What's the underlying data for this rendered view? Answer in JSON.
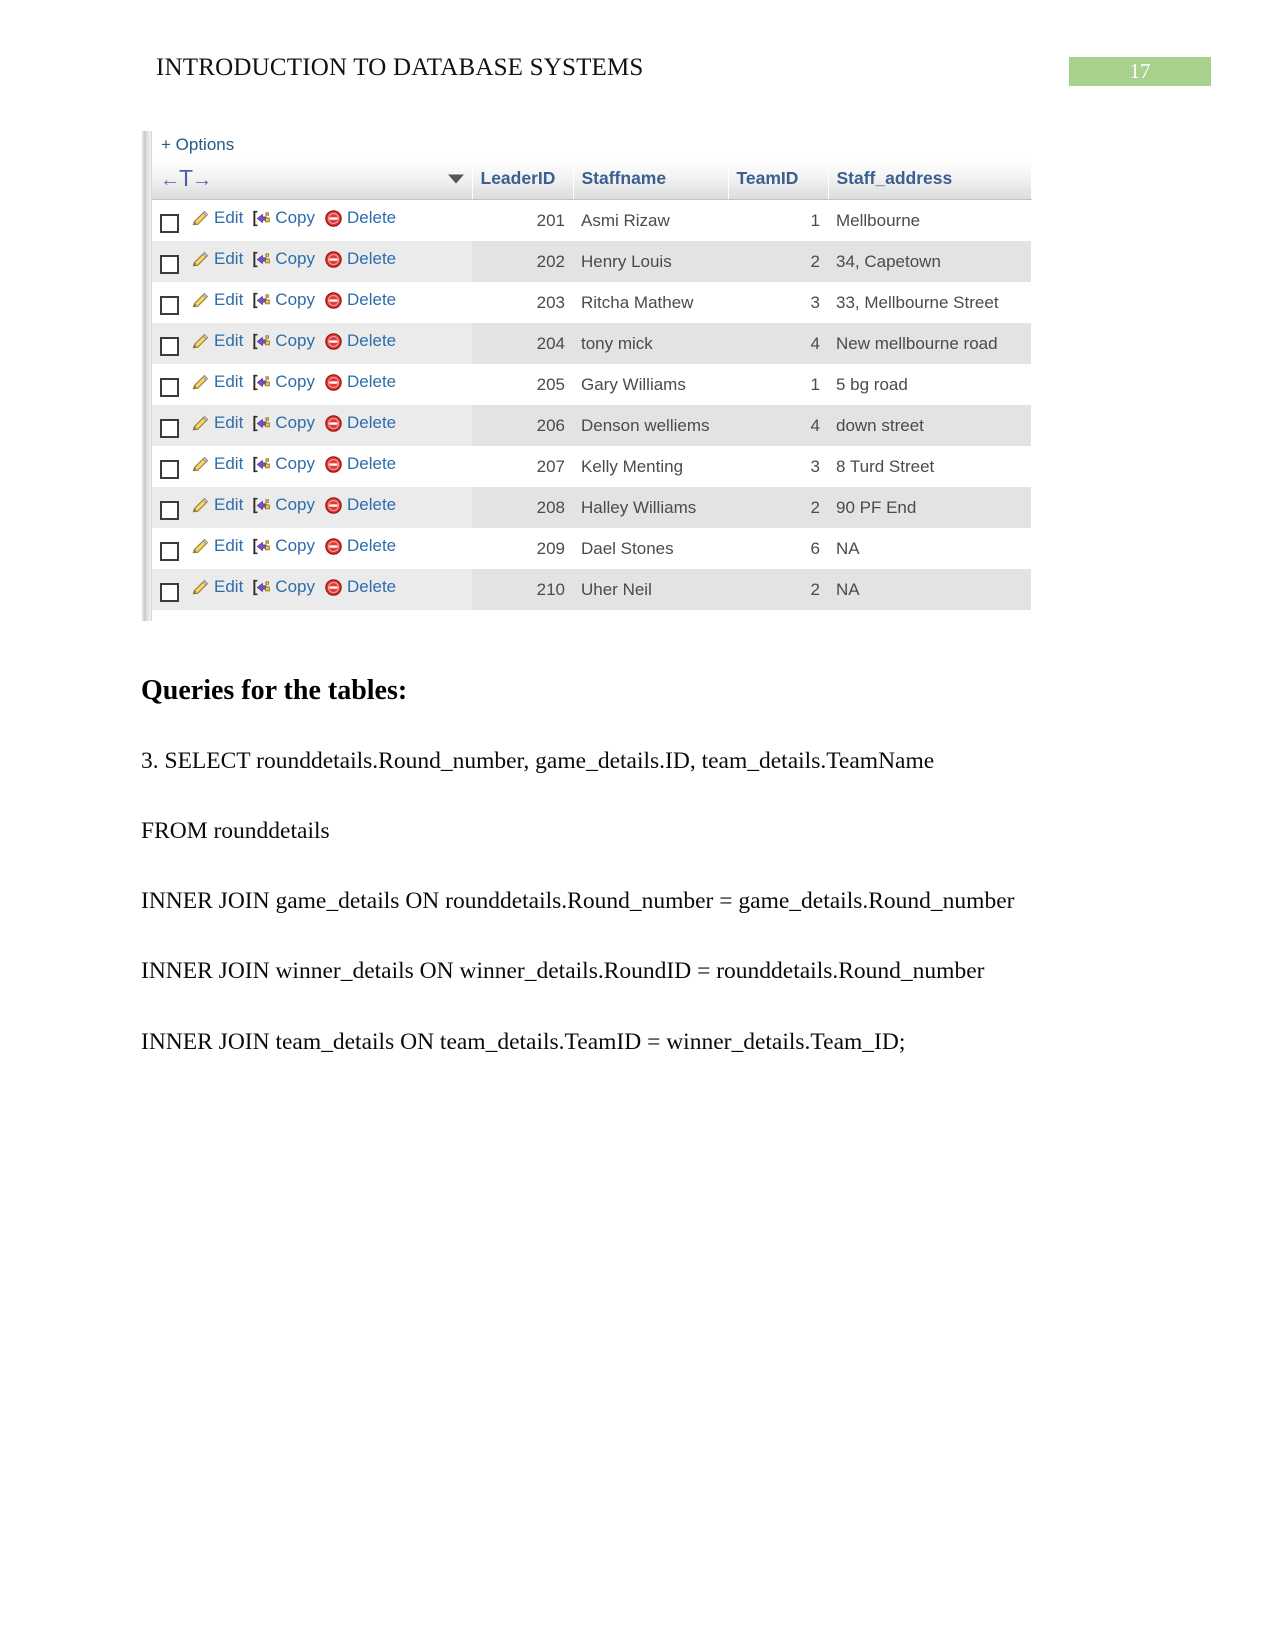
{
  "header": {
    "title": "INTRODUCTION TO DATABASE SYSTEMS",
    "page_number": "17",
    "badge_color": "#a9d18e"
  },
  "screenshot": {
    "options_label": "+ Options",
    "tnav": {
      "left_arrow": "←",
      "letter": "T",
      "right_arrow": "→"
    },
    "columns": [
      "LeaderID",
      "Staffname",
      "TeamID",
      "Staff_address"
    ],
    "actions": {
      "edit": "Edit",
      "copy": "Copy",
      "delete": "Delete"
    },
    "rows": [
      {
        "leader_id": "201",
        "staffname": "Asmi Rizaw",
        "team_id": "1",
        "staff_address": "Mellbourne"
      },
      {
        "leader_id": "202",
        "staffname": "Henry Louis",
        "team_id": "2",
        "staff_address": "34, Capetown"
      },
      {
        "leader_id": "203",
        "staffname": "Ritcha Mathew",
        "team_id": "3",
        "staff_address": "33, Mellbourne Street"
      },
      {
        "leader_id": "204",
        "staffname": "tony mick",
        "team_id": "4",
        "staff_address": "New mellbourne road"
      },
      {
        "leader_id": "205",
        "staffname": "Gary Williams",
        "team_id": "1",
        "staff_address": "5 bg road"
      },
      {
        "leader_id": "206",
        "staffname": "Denson welliems",
        "team_id": "4",
        "staff_address": "down street"
      },
      {
        "leader_id": "207",
        "staffname": "Kelly Menting",
        "team_id": "3",
        "staff_address": "8 Turd Street"
      },
      {
        "leader_id": "208",
        "staffname": "Halley Williams",
        "team_id": "2",
        "staff_address": "90 PF End"
      },
      {
        "leader_id": "209",
        "staffname": "Dael Stones",
        "team_id": "6",
        "staff_address": "NA"
      },
      {
        "leader_id": "210",
        "staffname": "Uher Neil",
        "team_id": "2",
        "staff_address": "NA"
      }
    ]
  },
  "content": {
    "section_heading": "Queries for the tables:",
    "query_lines": [
      "3. SELECT rounddetails.Round_number, game_details.ID, team_details.TeamName",
      "FROM rounddetails",
      "INNER JOIN game_details ON rounddetails.Round_number = game_details.Round_number",
      "INNER JOIN winner_details ON winner_details.RoundID = rounddetails.Round_number",
      "INNER JOIN team_details ON team_details.TeamID = winner_details.Team_ID;"
    ]
  }
}
